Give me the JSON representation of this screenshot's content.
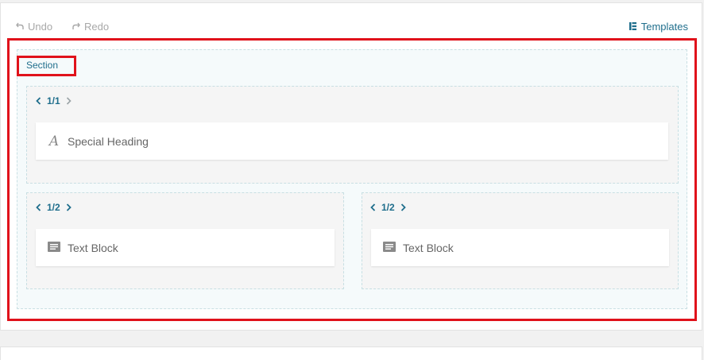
{
  "toolbar": {
    "undo_label": "Undo",
    "redo_label": "Redo",
    "templates_label": "Templates",
    "undo_icon": "undo-icon",
    "redo_icon": "redo-icon",
    "templates_icon": "templates-icon"
  },
  "section": {
    "label": "Section"
  },
  "rows": [
    {
      "columns": [
        {
          "width_label": "1/1",
          "elements": [
            {
              "icon": "special-heading-icon",
              "label": "Special Heading"
            }
          ]
        }
      ]
    },
    {
      "columns": [
        {
          "width_label": "1/2",
          "elements": [
            {
              "icon": "text-block-icon",
              "label": "Text Block"
            }
          ]
        },
        {
          "width_label": "1/2",
          "elements": [
            {
              "icon": "text-block-icon",
              "label": "Text Block"
            }
          ]
        }
      ]
    }
  ],
  "colors": {
    "accent": "#1f6e8c",
    "highlight": "#e0121b",
    "disabled_text": "#a8a8a8"
  }
}
